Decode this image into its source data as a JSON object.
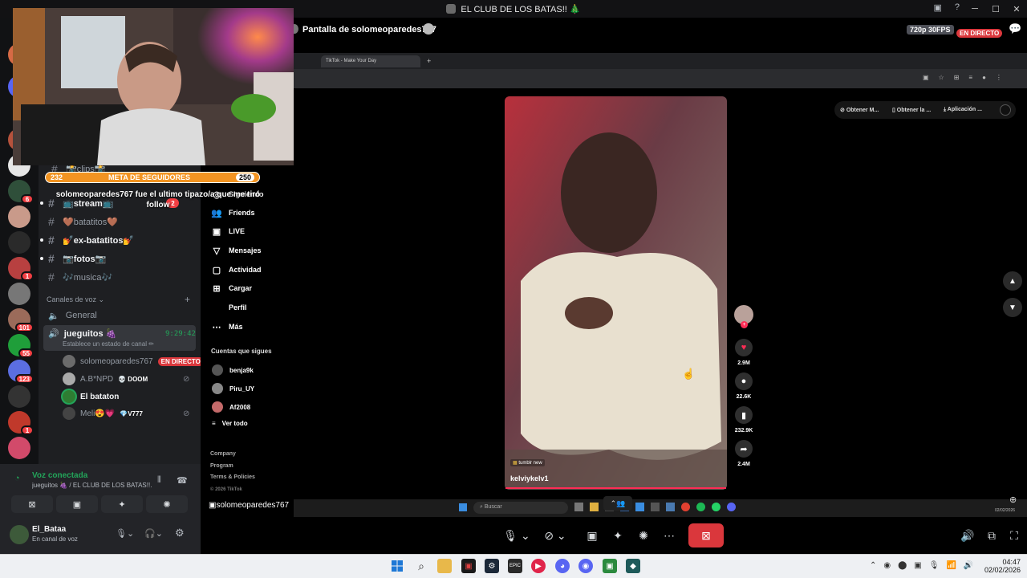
{
  "window": {
    "title": "EL CLUB DE LOS BATAS!! 🎄",
    "minimize": "─",
    "maximize": "☐",
    "close": "✕"
  },
  "stream": {
    "header_title": "Pantalla de solomeoparedes767",
    "quality": "720p 30FPS",
    "live_label": "EN DIRECTO",
    "streamer_tag": "solomeoparedes767"
  },
  "overlay": {
    "follow_current": "232",
    "follow_label": "META DE SEGUIDORES",
    "follow_goal": "250",
    "follow_message": "solomeoparedes767 fue el ultimo tipazo/a que me tiró follow"
  },
  "channels": {
    "text": [
      {
        "label": "📸clips📸"
      },
      {
        "label": "📺stream📺",
        "badge": "2"
      },
      {
        "label": "🤎batatitos🤎"
      },
      {
        "label": "💅ex-batatitos💅"
      },
      {
        "label": "📷fotos📷"
      },
      {
        "label": "🎶musica🎶"
      }
    ],
    "voice_category": "Canales de voz",
    "voice_general": "General",
    "voice_active": "jueguitos 🍇",
    "voice_timer": "9:29:42",
    "voice_status": "Establece un estado de canal ✏",
    "users": [
      {
        "name": "solomeoparedes767",
        "tag": "EN DIRECTO"
      },
      {
        "name": "A.B*NPD",
        "tag": "💀 DOOM"
      },
      {
        "name": "El bataton",
        "tag": ""
      },
      {
        "name": "Meli😍💗",
        "tag": "💎V777"
      }
    ]
  },
  "voice_panel": {
    "status": "Voz conectada",
    "location": "jueguitos 🍇 / EL CLUB DE LOS BATAS!!...",
    "username": "El_Bataa",
    "user_status": "En canal de voz"
  },
  "servers": {
    "badges": [
      "6",
      "1",
      "101",
      "55",
      "123",
      "1",
      "1"
    ]
  },
  "browser": {
    "tab_title": "TikTok - Make Your Day",
    "extensions": [
      "Obtener M...",
      "Obtener la ...",
      "Aplicación ..."
    ]
  },
  "tiktok": {
    "nav": [
      "Siguiendo",
      "Friends",
      "LIVE",
      "Mensajes",
      "Actividad",
      "Cargar",
      "Perfil",
      "Más"
    ],
    "following_title": "Cuentas que sigues",
    "following": [
      "benja9k",
      "Piru_UY",
      "Af2008"
    ],
    "see_all": "Ver todo",
    "footer": [
      "Company",
      "Program",
      "Terms & Policies",
      "© 2026 TikTok"
    ],
    "video_author": "kelviykelv1",
    "video_tag": "tumblr new",
    "counts": {
      "likes": "2.9M",
      "comments": "22.6K",
      "saves": "232.9K",
      "shares": "2.4M"
    }
  },
  "inner_taskbar": {
    "search_placeholder": "Buscar",
    "date": "02/02/2026"
  },
  "taskbar": {
    "time": "04:47",
    "date": "02/02/2026"
  },
  "colors": {
    "discord_dark": "#1e1f22",
    "live_red": "#da373c",
    "voice_green": "#23a55a",
    "follow_orange": "#f29422",
    "disconnect_red": "#da373c"
  }
}
